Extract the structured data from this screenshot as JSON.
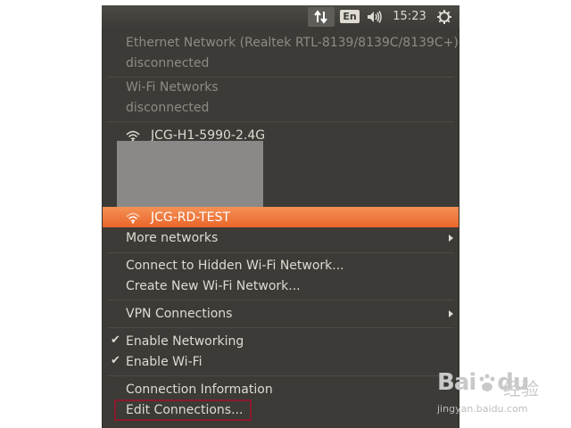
{
  "panel": {
    "network_icon": "network-arrows-icon",
    "language": "En",
    "sound_icon": "speaker-icon",
    "clock": "15:23",
    "session_icon": "gear-power-icon"
  },
  "menu": {
    "ethernet_title": "Ethernet Network (Realtek RTL-8139/8139C/8139C+)",
    "ethernet_status": "disconnected",
    "wifi_title": "Wi-Fi Networks",
    "wifi_status": "disconnected",
    "network_1": "JCG-H1-5990-2.4G",
    "network_active": "JCG-RD-TEST",
    "more_networks": "More networks",
    "connect_hidden": "Connect to Hidden Wi-Fi Network...",
    "create_new": "Create New Wi-Fi Network...",
    "vpn": "VPN Connections",
    "enable_networking": "Enable Networking",
    "enable_wifi": "Enable Wi-Fi",
    "check_mark": "✔",
    "connection_info": "Connection Information",
    "edit_connections": "Edit Connections..."
  },
  "watermark": {
    "logo": "Bai",
    "logo_tail": "du",
    "cn": "经验",
    "url": "jingyan.baidu.com"
  },
  "colors": {
    "menu_bg": "#3c3b37",
    "highlight": "#e9662a",
    "text": "#dfdbd2",
    "disabled_text": "#8e8b84",
    "annotation_box": "#8b1a2e"
  }
}
